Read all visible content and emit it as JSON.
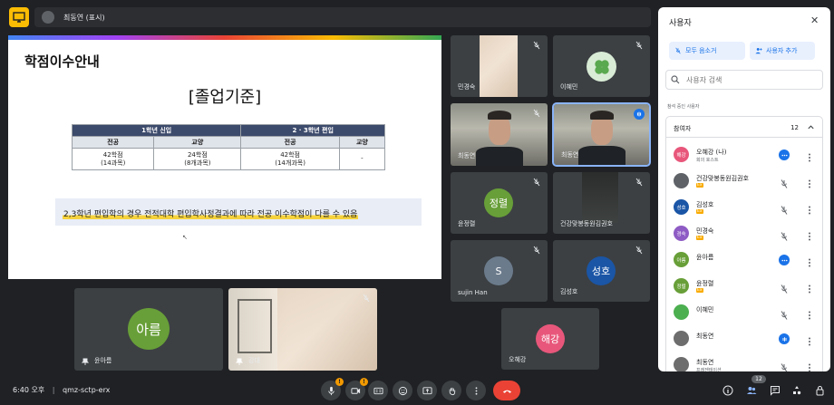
{
  "topbar": {
    "presenter": "최동연 (표시)"
  },
  "slide": {
    "title": "학점이수안내",
    "subtitle": "[졸업기준]",
    "table": {
      "group_headers": [
        "1학년 신입",
        "2 · 3학년 편입"
      ],
      "sub_headers": [
        "전공",
        "교양",
        "전공",
        "교양"
      ],
      "cells": [
        "42학점\n(14과목)",
        "24학점\n(8개과목)",
        "42학점\n(14개과목)",
        "-"
      ]
    },
    "note": "2,3학년 편입학의 경우 전적대학 편입학사정결과에 따라 전공 이수학점이 다를 수 있음"
  },
  "tiles": {
    "t1": "민경숙",
    "t2": "이혜민",
    "t3": "최동연",
    "t4": "최동연",
    "t5": {
      "name": "윤정렬",
      "initials": "정렬"
    },
    "t6": "건강맞봉동원김권호",
    "t7": {
      "name": "sujin Han",
      "initials": "S"
    },
    "t8": {
      "name": "김성호",
      "initials": "성호"
    },
    "t9": {
      "name": "오혜강",
      "initials": "해강"
    },
    "b1": {
      "name": "윤아름",
      "initials": "아름"
    },
    "b2": "강대"
  },
  "bottombar": {
    "time": "6:40 오후",
    "separator": "|",
    "meeting_code": "qmz-sctp-erx",
    "participant_count": "12"
  },
  "panel": {
    "title": "사용자",
    "mute_all": "모두 음소거",
    "add_people": "사용자 추가",
    "search_placeholder": "사용자 검색",
    "in_call": "참석 중인 사용자",
    "group_label": "참여자",
    "group_count": "12",
    "participants": [
      {
        "name": "오혜강 (나)",
        "sub": "회의 호스트",
        "initials": "해강",
        "color": "#e8577b",
        "audio": "speaking"
      },
      {
        "name": "건강맞봉동원김권호",
        "tag": "Ex",
        "initials": "",
        "color": "#5f6368",
        "audio": "muted"
      },
      {
        "name": "김성호",
        "tag": "Ex",
        "initials": "성호",
        "color": "#1a55a6",
        "audio": "muted"
      },
      {
        "name": "민경숙",
        "tag": "Ex",
        "initials": "경숙",
        "color": "#8e5cc4",
        "audio": "muted"
      },
      {
        "name": "윤아름",
        "initials": "아름",
        "color": "#689f38",
        "audio": "speaking"
      },
      {
        "name": "윤정렬",
        "tag": "Ex",
        "initials": "정렬",
        "color": "#689f38",
        "audio": "muted"
      },
      {
        "name": "이혜민",
        "initials": "",
        "color": "#4caf50",
        "audio": "muted"
      },
      {
        "name": "최동연",
        "initials": "",
        "color": "#6d6d6d",
        "audio": "active"
      },
      {
        "name": "최동연",
        "sub": "프레젠테이션",
        "initials": "",
        "color": "#6d6d6d",
        "audio": "muted"
      }
    ]
  },
  "colors": {
    "accent": "#1a73e8",
    "hangup": "#ea4335",
    "background": "#202124",
    "tile": "#3c4043"
  }
}
